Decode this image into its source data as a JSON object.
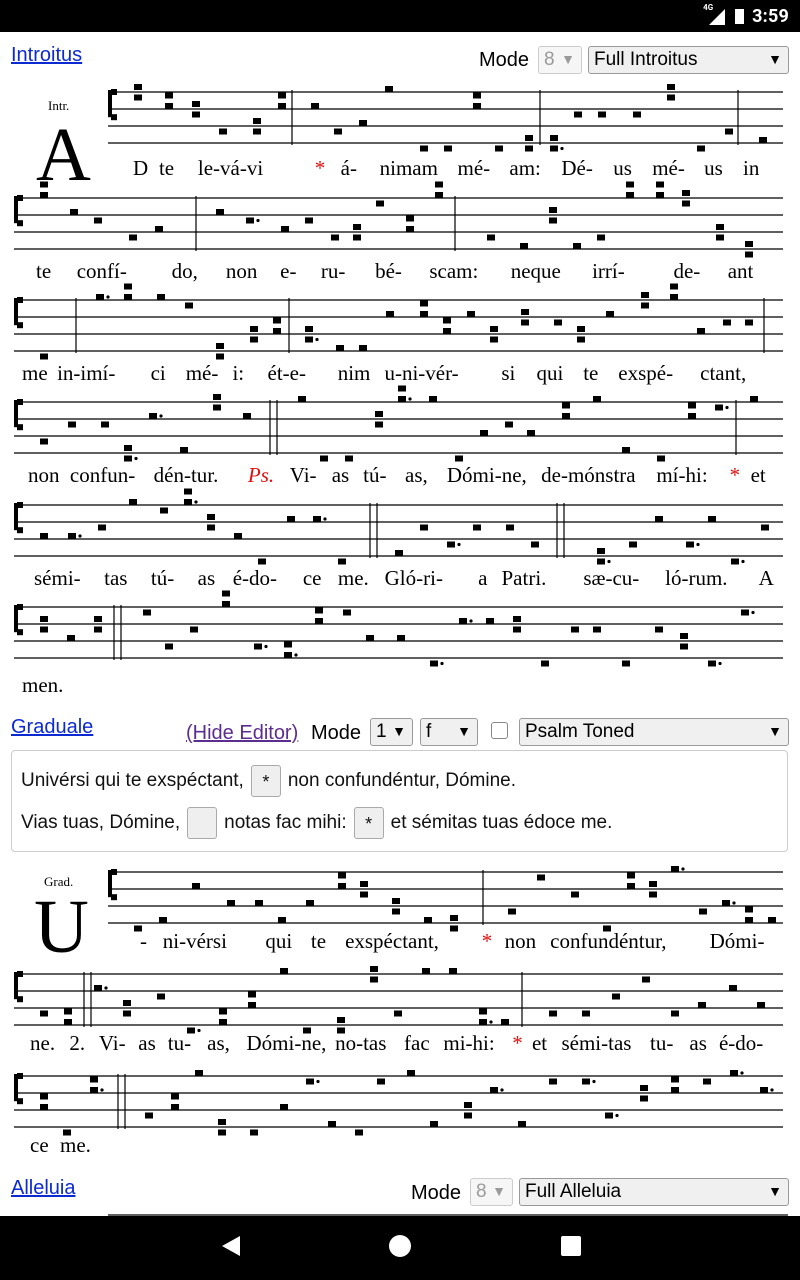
{
  "status": {
    "signal_label": "4G",
    "time": "3:59"
  },
  "introitus": {
    "link": "Introitus",
    "mode_label": "Mode",
    "mode_value": "8",
    "type_value": "Full Introitus",
    "cue": "Intr.",
    "initial": "A",
    "lines": [
      [
        "D",
        "te",
        "le-vá-vi",
        "*",
        "á-",
        "nimam",
        "mé-",
        "am:",
        "Dé-",
        "us",
        "mé-",
        "us",
        "in"
      ],
      [
        "te",
        "confí-",
        "do,",
        "non",
        "e-",
        "ru-",
        "bé-",
        "scam:",
        "neque",
        "irrí-",
        "de-",
        "ant"
      ],
      [
        "me",
        "in-imí-",
        "ci",
        "mé-",
        "i:",
        "ét-e-",
        "nim",
        "u-ni-vér-",
        "si",
        "qui",
        "te",
        "exspé-",
        "ctant,"
      ],
      [
        "non",
        "confun-",
        "dén-tur.",
        "Ps.",
        "Vi-",
        "as",
        "tú-",
        "as,",
        "Dómi-ne,",
        "de-mónstra",
        "mí-hi:",
        "*",
        "et"
      ],
      [
        "sémi-",
        "tas",
        "tú-",
        "as",
        "é-do-",
        "ce",
        "me.",
        "Gló-ri-",
        "a",
        "Patri.",
        "sæ-cu-",
        "ló-rum.",
        "A"
      ],
      [
        "men."
      ]
    ]
  },
  "graduale": {
    "link": "Graduale",
    "hide_editor": "(Hide Editor)",
    "mode_label": "Mode",
    "mode_value": "1",
    "key_value": "f",
    "type_value": "Psalm Toned",
    "editor": {
      "line1_a": "Univérsi qui te exspéctant,",
      "line1_btn": "*",
      "line1_b": "non confundéntur, Dómine.",
      "line2_a": "Vias tuas, Dómine,",
      "line2_btn1": "",
      "line2_b": "notas fac mihi:",
      "line2_btn2": "*",
      "line2_c": "et sémitas tuas édoce me."
    },
    "cue": "Grad.",
    "initial": "U",
    "lines": [
      [
        "-",
        "ni-vérsi",
        "qui",
        "te",
        "exspéctant,",
        "*",
        "non",
        "confundéntur,",
        "Dómi-"
      ],
      [
        "ne.",
        "2.",
        "Vi-",
        "as",
        "tu-",
        "as,",
        "Dómi-ne,",
        "no-tas",
        "fac",
        "mi-hi:",
        "*",
        "et",
        "sémi-tas",
        "tu-",
        "as",
        "é-do-"
      ],
      [
        "ce",
        "me."
      ]
    ]
  },
  "alleluia": {
    "link": "Alleluia",
    "mode_label": "Mode",
    "mode_value": "8",
    "type_value": "Full Alleluia"
  }
}
